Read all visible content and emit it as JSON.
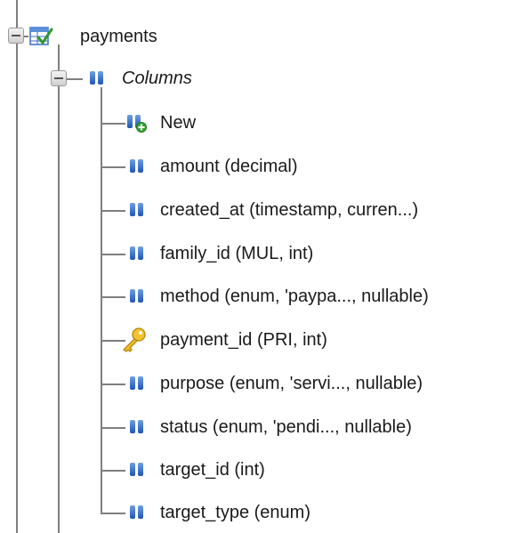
{
  "table": {
    "name": "payments",
    "columns_label": "Columns",
    "new_label": "New",
    "columns": [
      {
        "label": "amount (decimal)",
        "icon": "column-icon"
      },
      {
        "label": "created_at (timestamp, curren...)",
        "icon": "column-icon"
      },
      {
        "label": "family_id (MUL, int)",
        "icon": "column-icon"
      },
      {
        "label": "method (enum, 'paypa..., nullable)",
        "icon": "column-icon"
      },
      {
        "label": "payment_id (PRI, int)",
        "icon": "primary-key-icon"
      },
      {
        "label": "purpose (enum, 'servi..., nullable)",
        "icon": "column-icon"
      },
      {
        "label": "status (enum, 'pendi..., nullable)",
        "icon": "column-icon"
      },
      {
        "label": "target_id (int)",
        "icon": "column-icon"
      },
      {
        "label": "target_type (enum)",
        "icon": "column-icon"
      }
    ]
  },
  "colors": {
    "tree_line": "#7f7f7f",
    "column_icon": "#1f56b5",
    "key_icon": "#f2c230",
    "new_badge": "#33a532"
  }
}
